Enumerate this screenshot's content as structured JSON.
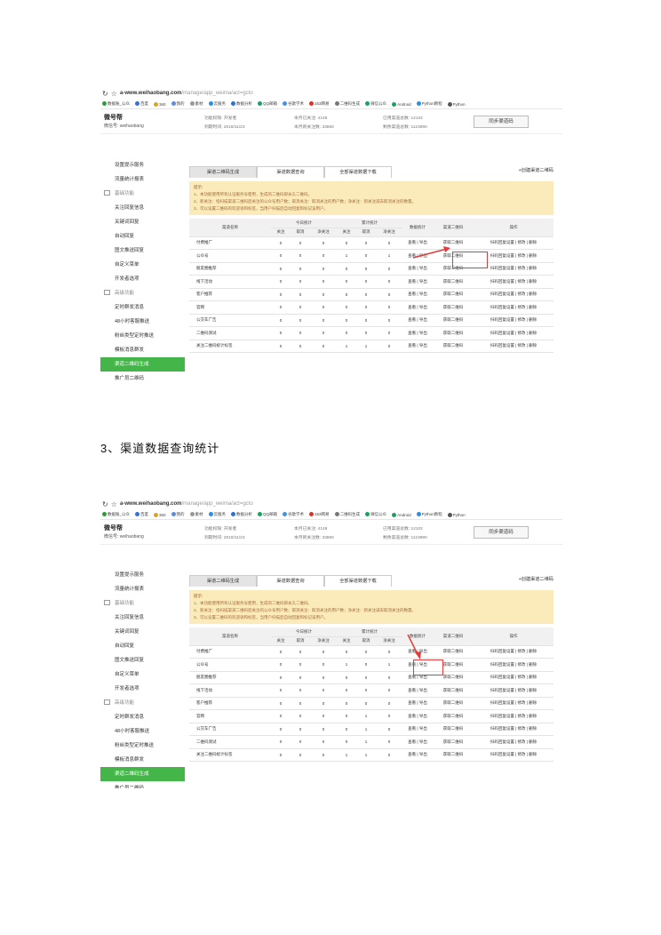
{
  "section_title": "3、渠道数据查询统计",
  "browser": {
    "url_host": "a-www.weihaobang.com",
    "url_path": "/manage/app_weima/act=gcto",
    "bookmarks": [
      "数据账_公众",
      "百度",
      "360",
      "我的",
      "素材",
      "云服务",
      "数据分析",
      "QQ邮箱",
      "谷歌学术",
      "163网易",
      "二维码生成",
      "微信公众",
      "Android",
      "Python教程",
      "Python"
    ]
  },
  "account": {
    "name": "微号帮",
    "id_label": "微信号: weihaobang",
    "stats": [
      "功能权限: 开发者",
      "到期时间: 2018/11/23",
      "本月已关注: 4149",
      "本月新关注数: 33860",
      "已用渠道总数: 12102",
      "剩余渠道总数: 1123990"
    ],
    "sync_button": "同步渠道码"
  },
  "sidebar": [
    {
      "type": "item",
      "label": "设置提示服务"
    },
    {
      "type": "item",
      "label": "流量统计报表"
    },
    {
      "type": "group",
      "label": "基础功能"
    },
    {
      "type": "item",
      "label": "关注回复信息"
    },
    {
      "type": "item",
      "label": "关键词回复"
    },
    {
      "type": "item",
      "label": "自动回复"
    },
    {
      "type": "item",
      "label": "图文推送回复"
    },
    {
      "type": "item",
      "label": "自定义菜单"
    },
    {
      "type": "item",
      "label": "开发者选项"
    },
    {
      "type": "group",
      "label": "高级功能"
    },
    {
      "type": "item",
      "label": "定时群发消息"
    },
    {
      "type": "item",
      "label": "48小时客服推送"
    },
    {
      "type": "item",
      "label": "粉丝类型定时推送"
    },
    {
      "type": "item",
      "label": "模板消息群发"
    },
    {
      "type": "item",
      "label": "渠道二维码生成",
      "active": true
    },
    {
      "type": "item",
      "label": "推广员二维码"
    }
  ],
  "tabs": [
    "渠道二维码生成",
    "渠道数据查询",
    "全部渠道数据下载"
  ],
  "new_link": "+创建渠道二维码",
  "notice": {
    "title": "提示:",
    "lines": [
      "1、本功能使用所有认证服务号使用，生成的二维码即永久二维码。",
      "2、新关注：指扫描渠道二维码后关注的公众号用户数；取消关注：取消关注的用户数；净关注：新关注减去取消关注的数量。",
      "3、可以设置二维码的欢迎语和标签，当用户扫描后自动回复和标记该用户。"
    ]
  },
  "table": {
    "headers": {
      "name": "渠道名称",
      "today": "今日统计",
      "total": "累计统计",
      "follow": "关注",
      "cancel": "取消",
      "net": "净关注",
      "stats": "数据统计",
      "qr": "渠道二维码",
      "ops": "操作"
    },
    "link_stats": "查看 | 导出",
    "link_qr": "获取二维码",
    "link_ops": "扫码回复设置 | 修改 | 删除",
    "rows1": [
      {
        "name": "付费推广",
        "v": [
          "0",
          "0",
          "0",
          "0",
          "0",
          "0"
        ]
      },
      {
        "name": "公众号",
        "v": [
          "0",
          "0",
          "0",
          "1",
          "0",
          "1"
        ]
      },
      {
        "name": "朋友圈推荐",
        "v": [
          "0",
          "0",
          "0",
          "0",
          "0",
          "0"
        ]
      },
      {
        "name": "线下活动",
        "v": [
          "0",
          "0",
          "0",
          "0",
          "0",
          "0"
        ]
      },
      {
        "name": "客户推荐",
        "v": [
          "0",
          "0",
          "0",
          "0",
          "0",
          "0"
        ]
      },
      {
        "name": "官网",
        "v": [
          "0",
          "0",
          "0",
          "0",
          "0",
          "0"
        ]
      },
      {
        "name": "公交车广告",
        "v": [
          "0",
          "0",
          "0",
          "0",
          "0",
          "0"
        ]
      },
      {
        "name": "二维码测试",
        "v": [
          "0",
          "0",
          "0",
          "0",
          "0",
          "0"
        ]
      },
      {
        "name": "关注二维码统计标签",
        "v": [
          "0",
          "0",
          "0",
          "1",
          "1",
          "0"
        ]
      }
    ],
    "rows2": [
      {
        "name": "付费推广",
        "v": [
          "0",
          "0",
          "0",
          "0",
          "0",
          "0"
        ]
      },
      {
        "name": "公众号",
        "v": [
          "0",
          "0",
          "0",
          "1",
          "0",
          "1"
        ]
      },
      {
        "name": "朋友圈推荐",
        "v": [
          "0",
          "0",
          "0",
          "0",
          "0",
          "0"
        ]
      },
      {
        "name": "线下活动",
        "v": [
          "0",
          "0",
          "0",
          "0",
          "0",
          "0"
        ]
      },
      {
        "name": "客户推荐",
        "v": [
          "0",
          "0",
          "0",
          "0",
          "0",
          "0"
        ]
      },
      {
        "name": "官网",
        "v": [
          "0",
          "0",
          "0",
          "0",
          "1",
          "0"
        ]
      },
      {
        "name": "公交车广告",
        "v": [
          "0",
          "0",
          "0",
          "0",
          "1",
          "0"
        ]
      },
      {
        "name": "二维码测试",
        "v": [
          "0",
          "0",
          "0",
          "0",
          "1",
          "0"
        ]
      },
      {
        "name": "关注二维码统计标签",
        "v": [
          "0",
          "0",
          "0",
          "1",
          "1",
          "0"
        ]
      }
    ]
  },
  "colors": {
    "accent_green": "#44b549",
    "notice_bg": "#fcebba",
    "highlight_red": "#e23b3b",
    "link_blue": "#3b6fb6"
  }
}
